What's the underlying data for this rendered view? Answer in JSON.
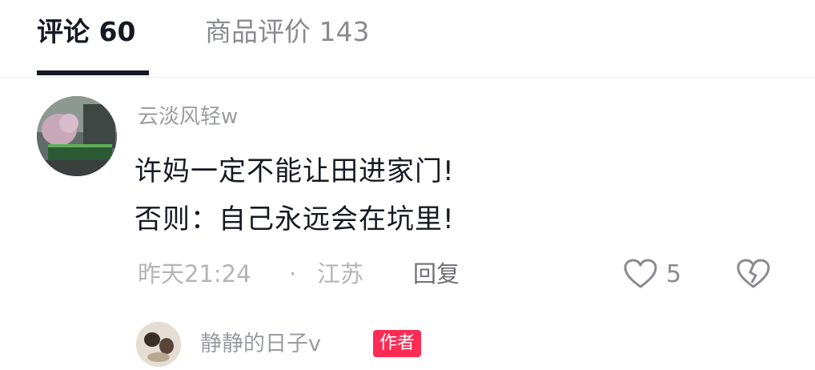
{
  "tabs": [
    {
      "label": "评论 60",
      "active": true
    },
    {
      "label": "商品评价 143",
      "active": false
    }
  ],
  "comment": {
    "username": "云淡风轻w",
    "lines": [
      "许妈一定不能让田进家门!",
      "否则：自己永远会在坑里!"
    ],
    "time": "昨天21:24",
    "separator": "·",
    "location": "江苏",
    "reply_label": "回复",
    "like_count": "5",
    "icons": {
      "like": "heart-outline-icon",
      "dislike": "broken-heart-icon"
    }
  },
  "reply": {
    "username": "静静的日子v",
    "badge": "作者"
  },
  "colors": {
    "text": "#161823",
    "muted": "#9b9ca3",
    "badge": "#fe2c55"
  }
}
